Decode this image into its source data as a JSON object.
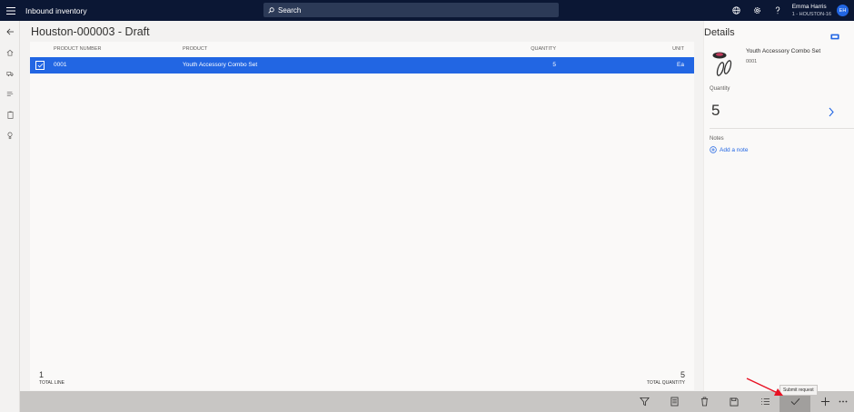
{
  "app": {
    "title": "Inbound inventory"
  },
  "search": {
    "label": "Search"
  },
  "user": {
    "name": "Emma Harris",
    "store": "1 - HOUSTON-16",
    "initials": "EH"
  },
  "page": {
    "title": "Houston-000003 - Draft"
  },
  "grid": {
    "headers": {
      "product_number": "PRODUCT NUMBER",
      "product": "PRODUCT",
      "quantity": "QUANTITY",
      "unit": "UNIT"
    },
    "rows": [
      {
        "product_number": "0001",
        "product": "Youth Accessory Combo Set",
        "quantity": "5",
        "unit": "Ea",
        "selected": true
      }
    ]
  },
  "totals": {
    "line_count": "1",
    "line_label": "TOTAL LINE",
    "quantity": "5",
    "quantity_label": "TOTAL QUANTITY"
  },
  "details": {
    "title": "Details",
    "product_name": "Youth Accessory Combo Set",
    "product_id": "0001",
    "quantity_label": "Quantity",
    "quantity_value": "5",
    "notes_label": "Notes",
    "add_note": "Add a note"
  },
  "commands": {
    "tooltip": "Submit request",
    "icons": [
      "filter-icon",
      "product-details-icon",
      "delete-icon",
      "save-icon",
      "list-icon",
      "checkmark-icon",
      "add-icon",
      "more-icon"
    ]
  },
  "colors": {
    "topbar": "#0b1734",
    "accent": "#2266e3",
    "commandbar": "#c8c6c4",
    "annotation_arrow": "#e81123"
  }
}
